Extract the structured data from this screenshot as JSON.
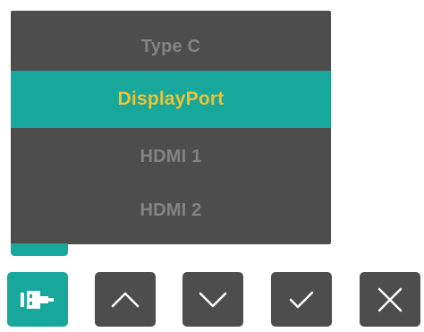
{
  "osd_menu": {
    "items": [
      {
        "label": "Type C",
        "selected": false
      },
      {
        "label": "DisplayPort",
        "selected": true
      },
      {
        "label": "HDMI 1",
        "selected": false
      },
      {
        "label": "HDMI 2",
        "selected": false
      }
    ]
  },
  "keys": [
    {
      "icon": "input-source-icon",
      "active": true
    },
    {
      "icon": "chevron-up-icon",
      "active": false
    },
    {
      "icon": "chevron-down-icon",
      "active": false
    },
    {
      "icon": "checkmark-icon",
      "active": false
    },
    {
      "icon": "close-icon",
      "active": false
    }
  ],
  "colors": {
    "panel": "#4d4d4d",
    "accent": "#17a89b",
    "selected_text": "#f1c232",
    "item_text": "#838383",
    "icon": "#ffffff"
  }
}
